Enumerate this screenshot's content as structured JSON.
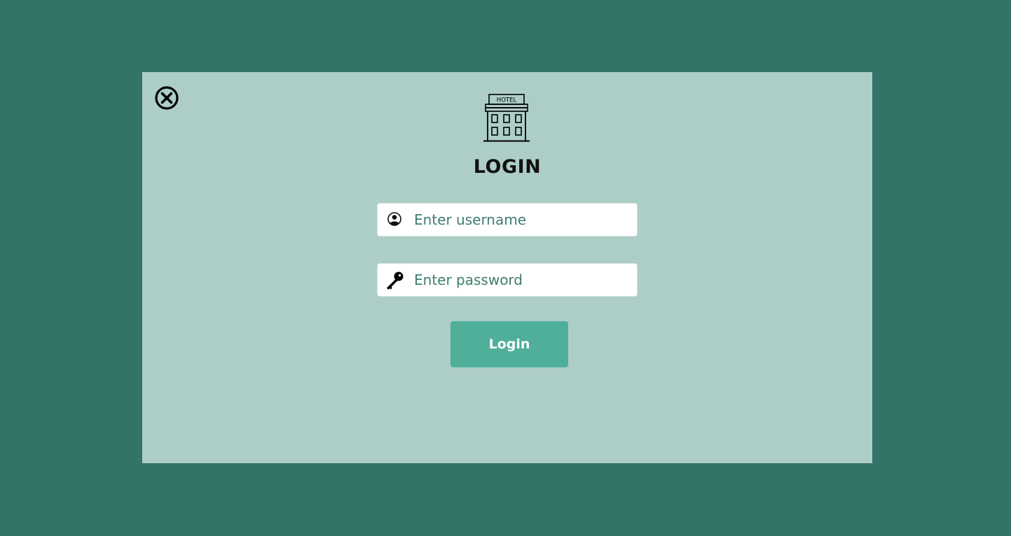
{
  "dialog": {
    "title": "LOGIN",
    "logo": {
      "icon": "hotel-building-icon",
      "sign_text": "HOTEL"
    },
    "close_icon": "close-circle-icon"
  },
  "form": {
    "username": {
      "icon": "user-circle-icon",
      "placeholder": "Enter username",
      "value": ""
    },
    "password": {
      "icon": "key-icon",
      "placeholder": "Enter password",
      "value": ""
    },
    "submit_label": "Login"
  },
  "colors": {
    "backdrop": "#347367",
    "dialog_background": "#adcec7",
    "button": "#4faf9b",
    "input_text": "#3f7c70"
  }
}
